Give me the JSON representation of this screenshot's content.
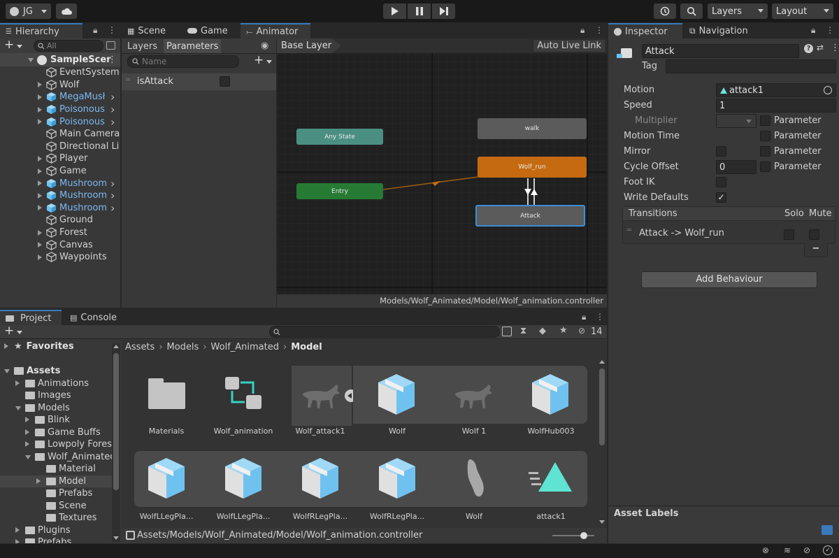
{
  "toolbar": {
    "account": "JG",
    "layers": "Layers",
    "layout": "Layout"
  },
  "hierarchy": {
    "tab": "Hierarchy",
    "search_placeholder": "All",
    "scene": "SampleScer",
    "items": [
      {
        "label": "EventSystem",
        "blue": false,
        "arrow": false,
        "indent": 1
      },
      {
        "label": "Wolf",
        "blue": false,
        "arrow": true,
        "indent": 1
      },
      {
        "label": "MegaMusł",
        "blue": true,
        "arrow": true,
        "indent": 1
      },
      {
        "label": "Poisonous",
        "blue": true,
        "arrow": true,
        "indent": 1
      },
      {
        "label": "Poisonous",
        "blue": true,
        "arrow": true,
        "indent": 1
      },
      {
        "label": "Main Camera",
        "blue": false,
        "arrow": false,
        "indent": 1
      },
      {
        "label": "Directional Li",
        "blue": false,
        "arrow": false,
        "indent": 1
      },
      {
        "label": "Player",
        "blue": false,
        "arrow": true,
        "indent": 1
      },
      {
        "label": "Game",
        "blue": false,
        "arrow": true,
        "indent": 1
      },
      {
        "label": "Mushroom",
        "blue": true,
        "arrow": true,
        "indent": 1
      },
      {
        "label": "Mushroom",
        "blue": true,
        "arrow": true,
        "indent": 1
      },
      {
        "label": "Mushroom",
        "blue": true,
        "arrow": true,
        "indent": 1
      },
      {
        "label": "Ground",
        "blue": false,
        "arrow": false,
        "indent": 1
      },
      {
        "label": "Forest",
        "blue": false,
        "arrow": true,
        "indent": 1
      },
      {
        "label": "Canvas",
        "blue": false,
        "arrow": true,
        "indent": 1
      },
      {
        "label": "Waypoints",
        "blue": false,
        "arrow": true,
        "indent": 1
      }
    ]
  },
  "center_tabs": {
    "scene": "Scene",
    "game": "Game",
    "animator": "Animator"
  },
  "animator": {
    "layers_tab": "Layers",
    "parameters_tab": "Parameters",
    "name_placeholder": "Name",
    "parameter": "isAttack",
    "base_layer": "Base Layer",
    "auto_live_link": "Auto Live Link",
    "path": "Models/Wolf_Animated/Model/Wolf_animation.controller",
    "nodes": {
      "any_state": "Any State",
      "entry": "Entry",
      "walk": "walk",
      "wolf_run": "Wolf_run",
      "attack": "Attack"
    }
  },
  "inspector": {
    "tab": "Inspector",
    "nav_tab": "Navigation",
    "name": "Attack",
    "tag_label": "Tag",
    "motion_label": "Motion",
    "motion_value": "attack1",
    "speed_label": "Speed",
    "speed_value": "1",
    "multiplier_label": "Multiplier",
    "motion_time_label": "Motion Time",
    "mirror_label": "Mirror",
    "cycle_offset_label": "Cycle Offset",
    "cycle_offset_value": "0",
    "foot_ik_label": "Foot IK",
    "write_defaults_label": "Write Defaults",
    "parameter_label": "Parameter",
    "transitions_header": "Transitions",
    "solo": "Solo",
    "mute": "Mute",
    "transition": "Attack -> Wolf_run",
    "minus": "−",
    "add_behaviour": "Add Behaviour",
    "asset_labels": "Asset Labels"
  },
  "project": {
    "tab": "Project",
    "console_tab": "Console",
    "hidden_count": "14",
    "breadcrumb": [
      "Assets",
      "Models",
      "Wolf_Animated",
      "Model"
    ],
    "tree": [
      {
        "label": "Favorites",
        "bold": true,
        "x": 6,
        "type": "star",
        "open": false
      },
      {
        "label": "Assets",
        "bold": true,
        "x": 6,
        "type": "folder",
        "open": true
      },
      {
        "label": "Animations",
        "bold": false,
        "x": 22,
        "type": "folder",
        "open": false,
        "arrow": true
      },
      {
        "label": "Images",
        "bold": false,
        "x": 22,
        "type": "folder",
        "open": false,
        "arrow": false
      },
      {
        "label": "Models",
        "bold": false,
        "x": 22,
        "type": "folder",
        "open": true,
        "arrow": true
      },
      {
        "label": "Blink",
        "bold": false,
        "x": 36,
        "type": "folder",
        "open": false,
        "arrow": true
      },
      {
        "label": "Game Buffs",
        "bold": false,
        "x": 36,
        "type": "folder",
        "open": false,
        "arrow": true
      },
      {
        "label": "Lowpoly Fores",
        "bold": false,
        "x": 36,
        "type": "folder",
        "open": false,
        "arrow": true
      },
      {
        "label": "Wolf_Animatec",
        "bold": false,
        "x": 36,
        "type": "folder",
        "open": true,
        "arrow": true
      },
      {
        "label": "Material",
        "bold": false,
        "x": 52,
        "type": "folder",
        "open": false,
        "arrow": false
      },
      {
        "label": "Model",
        "bold": false,
        "x": 52,
        "type": "folder",
        "open": false,
        "arrow": true,
        "selected": true
      },
      {
        "label": "Prefabs",
        "bold": false,
        "x": 52,
        "type": "folder",
        "open": false,
        "arrow": false
      },
      {
        "label": "Scene",
        "bold": false,
        "x": 52,
        "type": "folder",
        "open": false,
        "arrow": false
      },
      {
        "label": "Textures",
        "bold": false,
        "x": 52,
        "type": "folder",
        "open": false,
        "arrow": false
      },
      {
        "label": "Plugins",
        "bold": false,
        "x": 22,
        "type": "folder",
        "open": false,
        "arrow": true
      },
      {
        "label": "Prefabs",
        "bold": false,
        "x": 22,
        "type": "folder",
        "open": false,
        "arrow": true
      }
    ],
    "assets_row1": [
      "Materials",
      "Wolf_animation",
      "Wolf_attack1",
      "Wolf",
      "Wolf 1",
      "WolfHub003"
    ],
    "assets_row2": [
      "WolfLLegPla...",
      "WolfLLegPla...",
      "WolfRLegPla...",
      "WolfRLegPla...",
      "Wolf",
      "attack1"
    ],
    "status_path": "Assets/Models/Wolf_Animated/Model/Wolf_animation.controller",
    "zoom": 0.75
  },
  "colors": {
    "accent": "#3a79bb",
    "any_state": "#4b8f83",
    "entry": "#267a34",
    "wolf_run": "#c56a11",
    "node_gray": "#5b5b5b",
    "cube_blue": "#6fc2ef"
  }
}
